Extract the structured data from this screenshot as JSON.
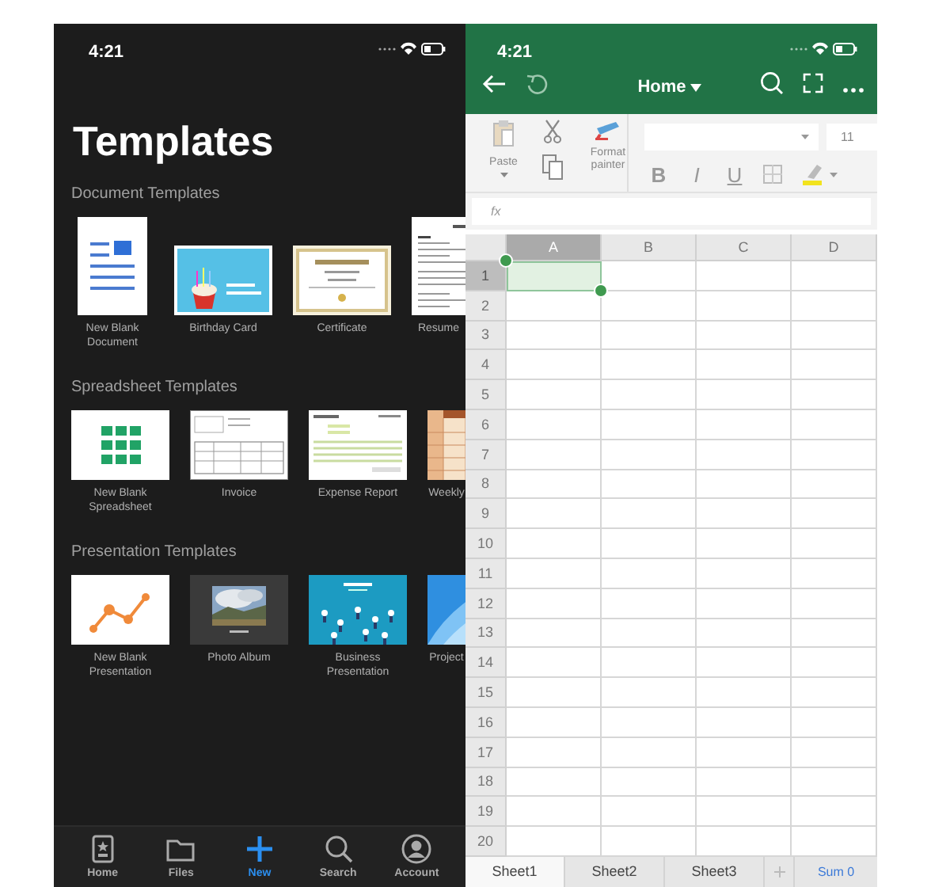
{
  "templates_screen": {
    "status_time": "4:21",
    "title": "Templates",
    "sections": [
      {
        "heading": "Document Templates",
        "templates": [
          {
            "label": "New Blank Document",
            "kind": "blank-doc"
          },
          {
            "label": "Birthday Card",
            "kind": "card"
          },
          {
            "label": "Certificate",
            "kind": "certificate"
          },
          {
            "label": "Resume",
            "kind": "resume"
          }
        ]
      },
      {
        "heading": "Spreadsheet Templates",
        "templates": [
          {
            "label": "New Blank Spreadsheet",
            "kind": "blank-sheet"
          },
          {
            "label": "Invoice",
            "kind": "invoice"
          },
          {
            "label": "Expense Report",
            "kind": "expense"
          },
          {
            "label": "Weekly",
            "kind": "weekly"
          }
        ]
      },
      {
        "heading": "Presentation Templates",
        "templates": [
          {
            "label": "New Blank Presentation",
            "kind": "blank-pres"
          },
          {
            "label": "Photo Album"
          },
          {
            "label": "Business Presentation",
            "kind": "business"
          },
          {
            "label": "Project",
            "kind": "project"
          }
        ]
      }
    ],
    "tab_bar": [
      {
        "label": "Home",
        "selected": false
      },
      {
        "label": "Files",
        "selected": false
      },
      {
        "label": "New",
        "selected": true
      },
      {
        "label": "Search",
        "selected": false
      },
      {
        "label": "Account",
        "selected": false
      }
    ]
  },
  "sheet_screen": {
    "status_time": "4:21",
    "toolbar_title": "Home",
    "ribbon": {
      "paste": "Paste",
      "format_painter": "Format painter",
      "font_size": "11",
      "format_buttons": [
        "B",
        "I",
        "U"
      ]
    },
    "formula_label": "fx",
    "columns": [
      {
        "label": "A",
        "selected": true
      },
      {
        "label": "B",
        "selected": false
      },
      {
        "label": "C",
        "selected": false
      },
      {
        "label": "D",
        "selected": false
      }
    ],
    "rows": [
      {
        "label": "1",
        "selected": true
      },
      {
        "label": "2",
        "selected": false
      },
      {
        "label": "3",
        "selected": false
      },
      {
        "label": "4",
        "selected": false
      },
      {
        "label": "5",
        "selected": false
      },
      {
        "label": "6",
        "selected": false
      },
      {
        "label": "7",
        "selected": false
      },
      {
        "label": "8",
        "selected": false
      },
      {
        "label": "9",
        "selected": false
      },
      {
        "label": "10",
        "selected": false
      },
      {
        "label": "11",
        "selected": false
      },
      {
        "label": "12",
        "selected": false
      },
      {
        "label": "13",
        "selected": false
      },
      {
        "label": "14",
        "selected": false
      },
      {
        "label": "15",
        "selected": false
      },
      {
        "label": "16",
        "selected": false
      },
      {
        "label": "17",
        "selected": false
      },
      {
        "label": "18",
        "selected": false
      },
      {
        "label": "19",
        "selected": false
      },
      {
        "label": "20",
        "selected": false
      }
    ],
    "sheet_tabs": [
      {
        "label": "Sheet1",
        "selected": true
      },
      {
        "label": "Sheet2",
        "selected": false
      },
      {
        "label": "Sheet3",
        "selected": false
      }
    ],
    "sum": "Sum 0"
  }
}
